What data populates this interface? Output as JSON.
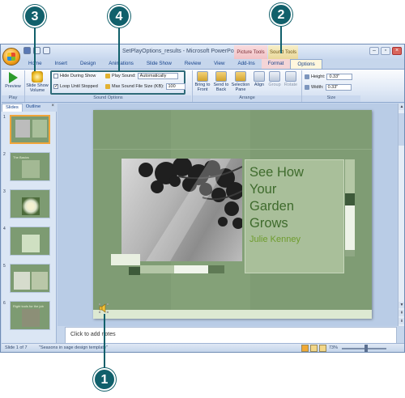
{
  "window": {
    "title": "SetPlayOptions_results - Microsoft PowerPoint",
    "context_picture": "Picture Tools",
    "context_sound": "Sound Tools"
  },
  "tabs": [
    "Home",
    "Insert",
    "Design",
    "Animations",
    "Slide Show",
    "Review",
    "View",
    "Add-Ins",
    "Format",
    "Options"
  ],
  "ribbon": {
    "preview_label": "Preview",
    "play_group": "Play",
    "slideshow_volume_line1": "Slide Show",
    "slideshow_volume_line2": "Volume",
    "hide_during_show": "Hide During Show",
    "loop_until_stopped": "Loop Until Stopped",
    "play_sound_label": "Play Sound:",
    "play_sound_value": "Automatically",
    "max_sound_label": "Max Sound File Size (KB):",
    "max_sound_value": "100",
    "sound_options_group": "Sound Options",
    "bring_to_front_1": "Bring to",
    "bring_to_front_2": "Front",
    "send_to_back_1": "Send to",
    "send_to_back_2": "Back",
    "selection_pane_1": "Selection",
    "selection_pane_2": "Pane",
    "align": "Align",
    "group": "Group",
    "rotate": "Rotate",
    "arrange_group": "Arrange",
    "height_label": "Height:",
    "height_value": "0.33\"",
    "width_label": "Width:",
    "width_value": "0.33\"",
    "size_group": "Size"
  },
  "left_pane": {
    "tab_slides": "Slides",
    "tab_outline": "Outline",
    "close": "×",
    "slides": [
      {
        "num": "1",
        "caption": ""
      },
      {
        "num": "2",
        "caption": "The Basics"
      },
      {
        "num": "3",
        "caption": ""
      },
      {
        "num": "4",
        "caption": ""
      },
      {
        "num": "5",
        "caption": ""
      },
      {
        "num": "6",
        "caption": "Right tools for the job"
      }
    ]
  },
  "slide": {
    "title": "See How\nYour\nGarden\nGrows",
    "subtitle": "Julie Kenney"
  },
  "notes": {
    "placeholder": "Click to add notes"
  },
  "status": {
    "slide_info": "Slide 1 of 7",
    "theme": "\"Seasons in sage design template\"",
    "zoom": "73%"
  },
  "callouts": [
    "1",
    "2",
    "3",
    "4"
  ],
  "colors": {
    "callout": "#11606b",
    "slide_bg": "#7f9c74",
    "title_text": "#3f6b2d",
    "subtitle_text": "#6e9c2d"
  }
}
